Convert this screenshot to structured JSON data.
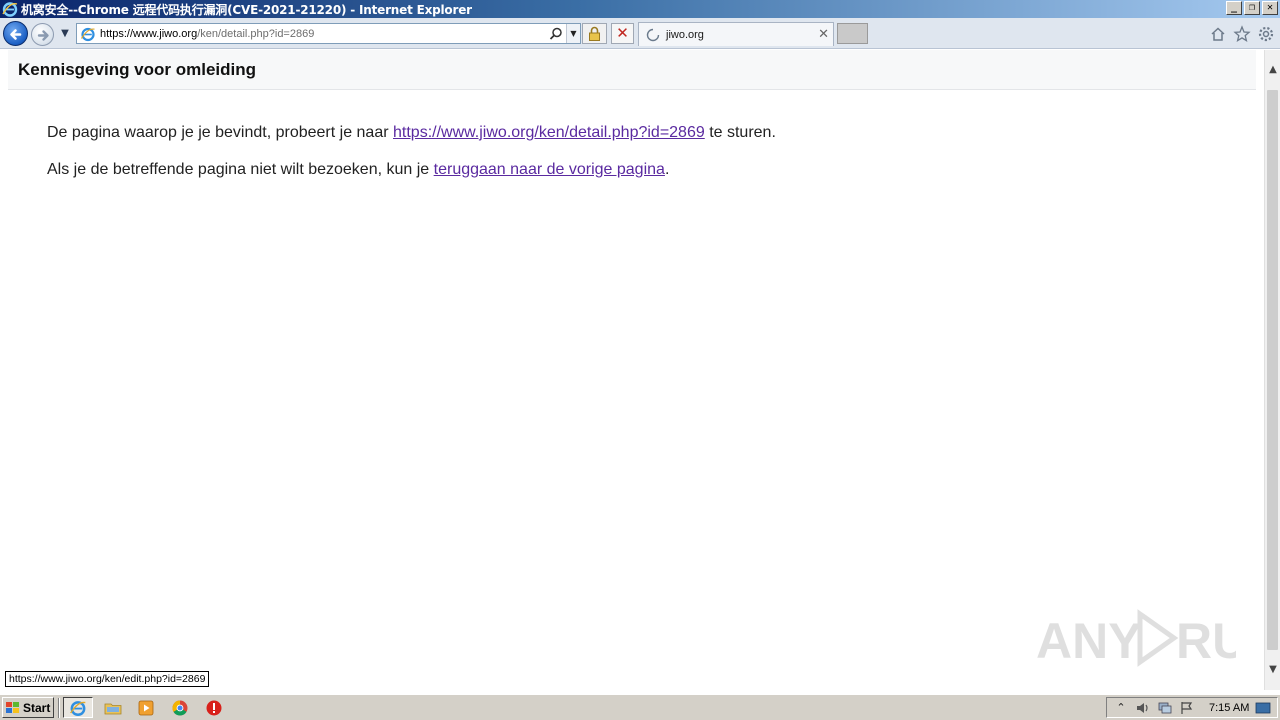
{
  "window": {
    "title": "机窝安全--Chrome 远程代码执行漏洞(CVE-2021-21220) - Internet Explorer"
  },
  "navbar": {
    "url_prefix": "https://www.",
    "url_domain": "jiwo.org",
    "url_path": "/ken/detail.php?id=2869",
    "tab_label": "jiwo.org"
  },
  "page": {
    "title": "Kennisgeving voor omleiding",
    "p1_before": "De pagina waarop je je bevindt, probeert je naar ",
    "p1_link": "https://www.jiwo.org/ken/detail.php?id=2869",
    "p1_after": " te sturen.",
    "p2_before": "Als je de betreffende pagina niet wilt bezoeken, kun je ",
    "p2_link": "teruggaan naar de vorige pagina",
    "p2_after": "."
  },
  "status": {
    "hover_url": "https://www.jiwo.org/ken/edit.php?id=2869"
  },
  "taskbar": {
    "start_label": "Start",
    "clock": "7:15 AM"
  },
  "colors": {
    "link": "#5a2aa0",
    "titlebar_start": "#0a246a",
    "titlebar_end": "#a6caf0"
  },
  "icons": {
    "browser": "ie-logo-icon",
    "back": "back-arrow-icon",
    "forward": "forward-arrow-icon",
    "search": "search-icon",
    "lock": "lock-icon",
    "stop": "close-icon",
    "home": "home-icon",
    "favorites": "star-icon",
    "tools": "gear-icon"
  }
}
